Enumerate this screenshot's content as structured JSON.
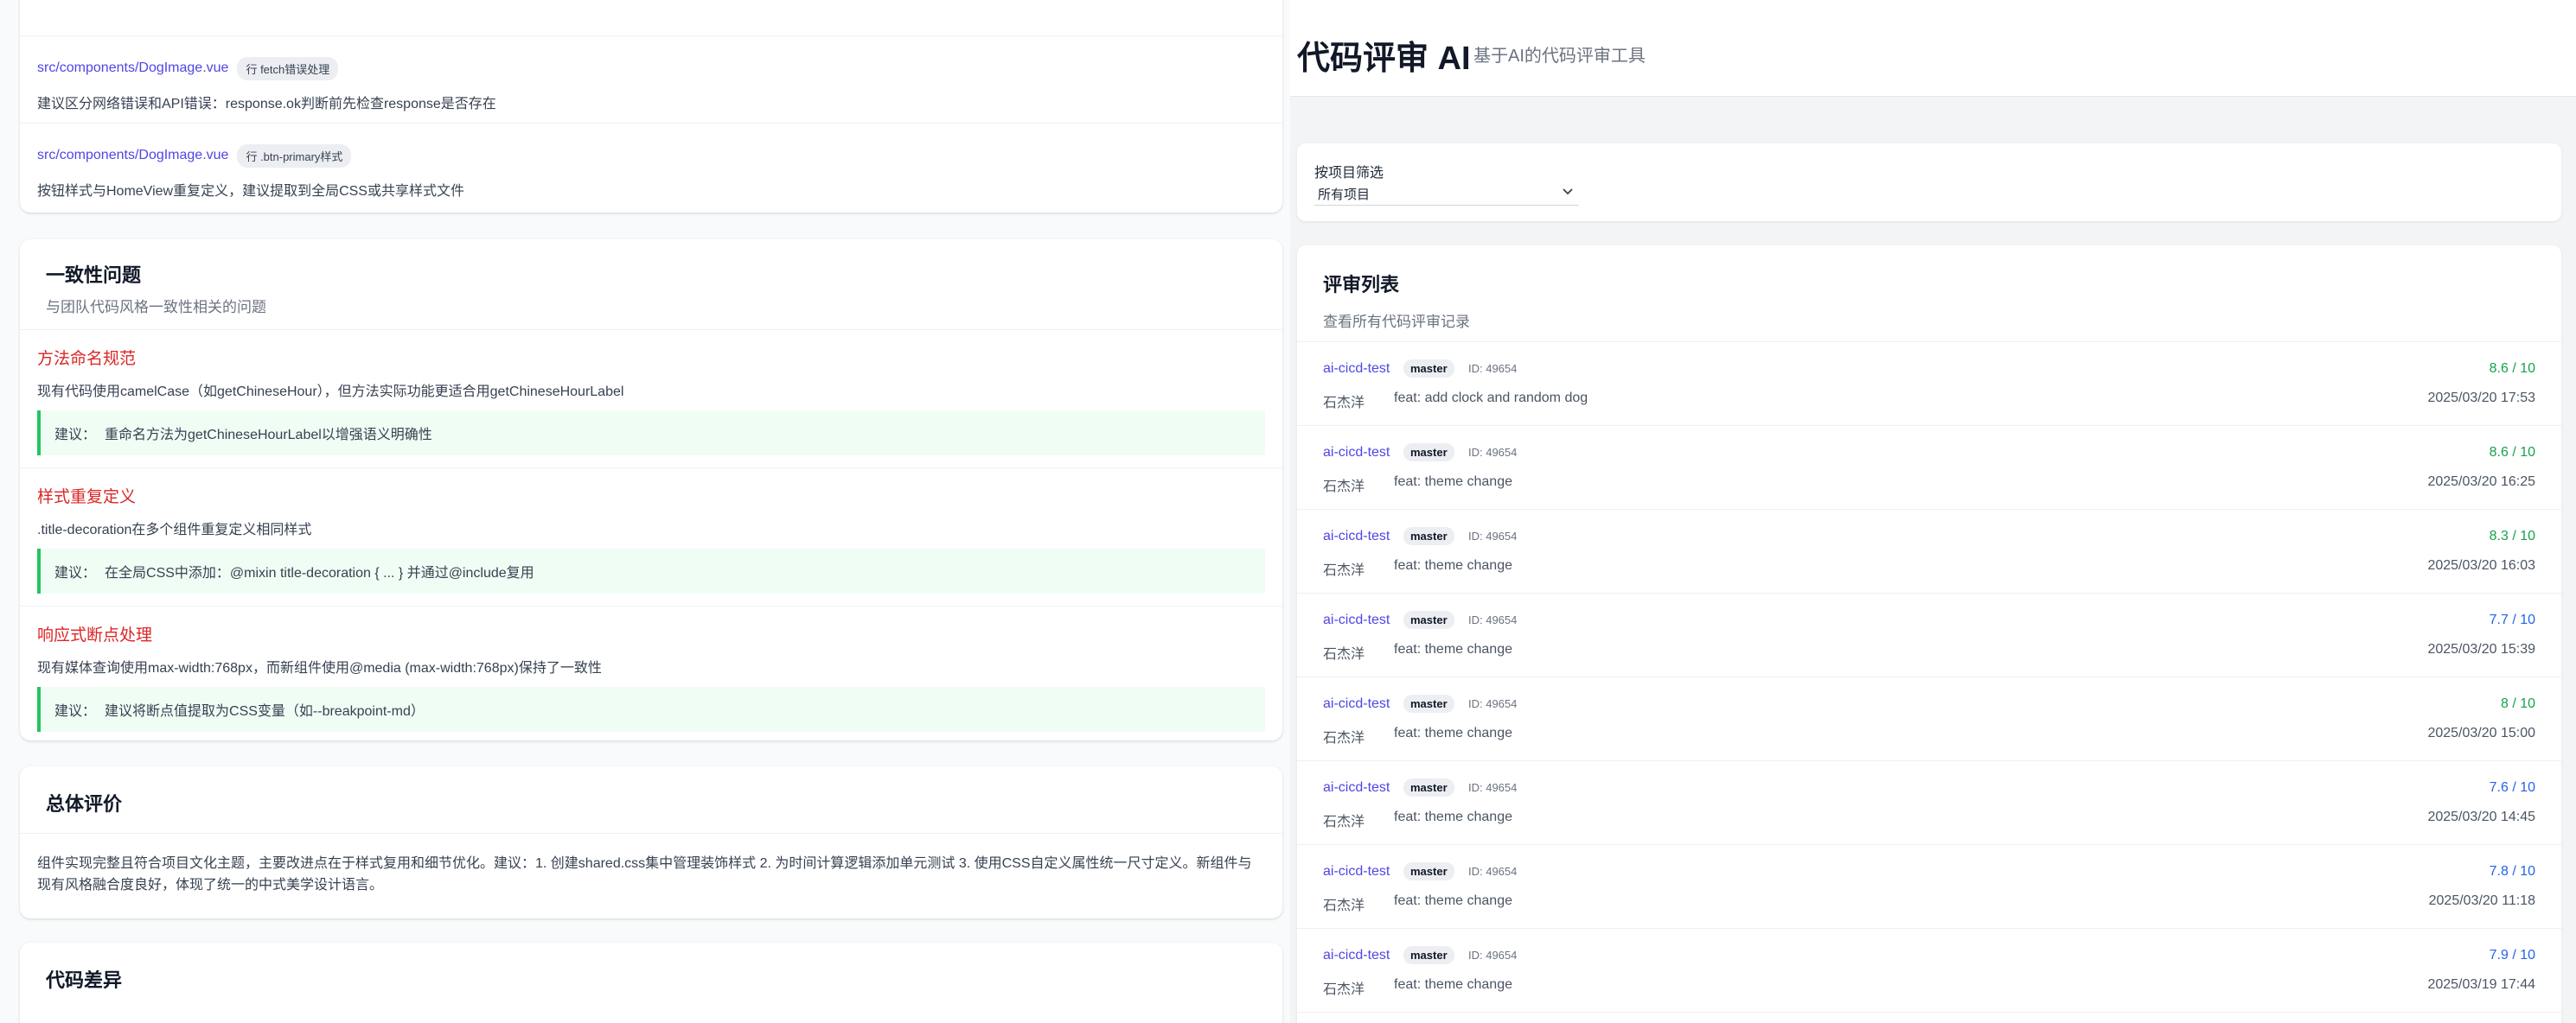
{
  "left": {
    "file_issues": [
      {
        "file": "src/components/DogImage.vue",
        "line": "行 fetch错误处理",
        "desc": "建议区分网络错误和API错误：response.ok判断前先检查response是否存在"
      },
      {
        "file": "src/components/DogImage.vue",
        "line": "行 .btn-primary样式",
        "desc": "按钮样式与HomeView重复定义，建议提取到全局CSS或共享样式文件"
      }
    ],
    "consistency": {
      "title": "一致性问题",
      "subtitle": "与团队代码风格一致性相关的问题",
      "suggest_label": "建议：",
      "items": [
        {
          "title": "方法命名规范",
          "desc": "现有代码使用camelCase（如getChineseHour），但方法实际功能更适合用getChineseHourLabel",
          "suggestion": "重命名方法为getChineseHourLabel以增强语义明确性"
        },
        {
          "title": "样式重复定义",
          "desc": ".title-decoration在多个组件重复定义相同样式",
          "suggestion": "在全局CSS中添加：@mixin title-decoration { ... } 并通过@include复用"
        },
        {
          "title": "响应式断点处理",
          "desc": "现有媒体查询使用max-width:768px，而新组件使用@media (max-width:768px)保持了一致性",
          "suggestion": "建议将断点值提取为CSS变量（如--breakpoint-md）"
        }
      ]
    },
    "summary": {
      "title": "总体评价",
      "text": "组件实现完整且符合项目文化主题，主要改进点在于样式复用和细节优化。建议：1. 创建shared.css集中管理装饰样式 2. 为时间计算逻辑添加单元测试 3. 使用CSS自定义属性统一尺寸定义。新组件与现有风格融合度良好，体现了统一的中式美学设计语言。"
    },
    "diff": {
      "title": "代码差异"
    }
  },
  "right": {
    "app_title": "代码评审 AI",
    "app_subtitle": "基于AI的代码评审工具",
    "filter": {
      "label": "按项目筛选",
      "selected": "所有项目"
    },
    "list": {
      "title": "评审列表",
      "subtitle": "查看所有代码评审记录",
      "reviews": [
        {
          "project": "ai-cicd-test",
          "branch": "master",
          "id": "ID: 49654",
          "score": "8.6 / 10",
          "color": "#16a34a",
          "author": "石杰洋",
          "message": "feat: add clock and random dog",
          "date": "2025/03/20 17:53"
        },
        {
          "project": "ai-cicd-test",
          "branch": "master",
          "id": "ID: 49654",
          "score": "8.6 / 10",
          "color": "#16a34a",
          "author": "石杰洋",
          "message": "feat: theme change",
          "date": "2025/03/20 16:25"
        },
        {
          "project": "ai-cicd-test",
          "branch": "master",
          "id": "ID: 49654",
          "score": "8.3 / 10",
          "color": "#16a34a",
          "author": "石杰洋",
          "message": "feat: theme change",
          "date": "2025/03/20 16:03"
        },
        {
          "project": "ai-cicd-test",
          "branch": "master",
          "id": "ID: 49654",
          "score": "7.7 / 10",
          "color": "#2563eb",
          "author": "石杰洋",
          "message": "feat: theme change",
          "date": "2025/03/20 15:39"
        },
        {
          "project": "ai-cicd-test",
          "branch": "master",
          "id": "ID: 49654",
          "score": "8 / 10",
          "color": "#16a34a",
          "author": "石杰洋",
          "message": "feat: theme change",
          "date": "2025/03/20 15:00"
        },
        {
          "project": "ai-cicd-test",
          "branch": "master",
          "id": "ID: 49654",
          "score": "7.6 / 10",
          "color": "#2563eb",
          "author": "石杰洋",
          "message": "feat: theme change",
          "date": "2025/03/20 14:45"
        },
        {
          "project": "ai-cicd-test",
          "branch": "master",
          "id": "ID: 49654",
          "score": "7.8 / 10",
          "color": "#2563eb",
          "author": "石杰洋",
          "message": "feat: theme change",
          "date": "2025/03/20 11:18"
        },
        {
          "project": "ai-cicd-test",
          "branch": "master",
          "id": "ID: 49654",
          "score": "7.9 / 10",
          "color": "#2563eb",
          "author": "石杰洋",
          "message": "feat: theme change",
          "date": "2025/03/19 17:44"
        }
      ]
    }
  }
}
